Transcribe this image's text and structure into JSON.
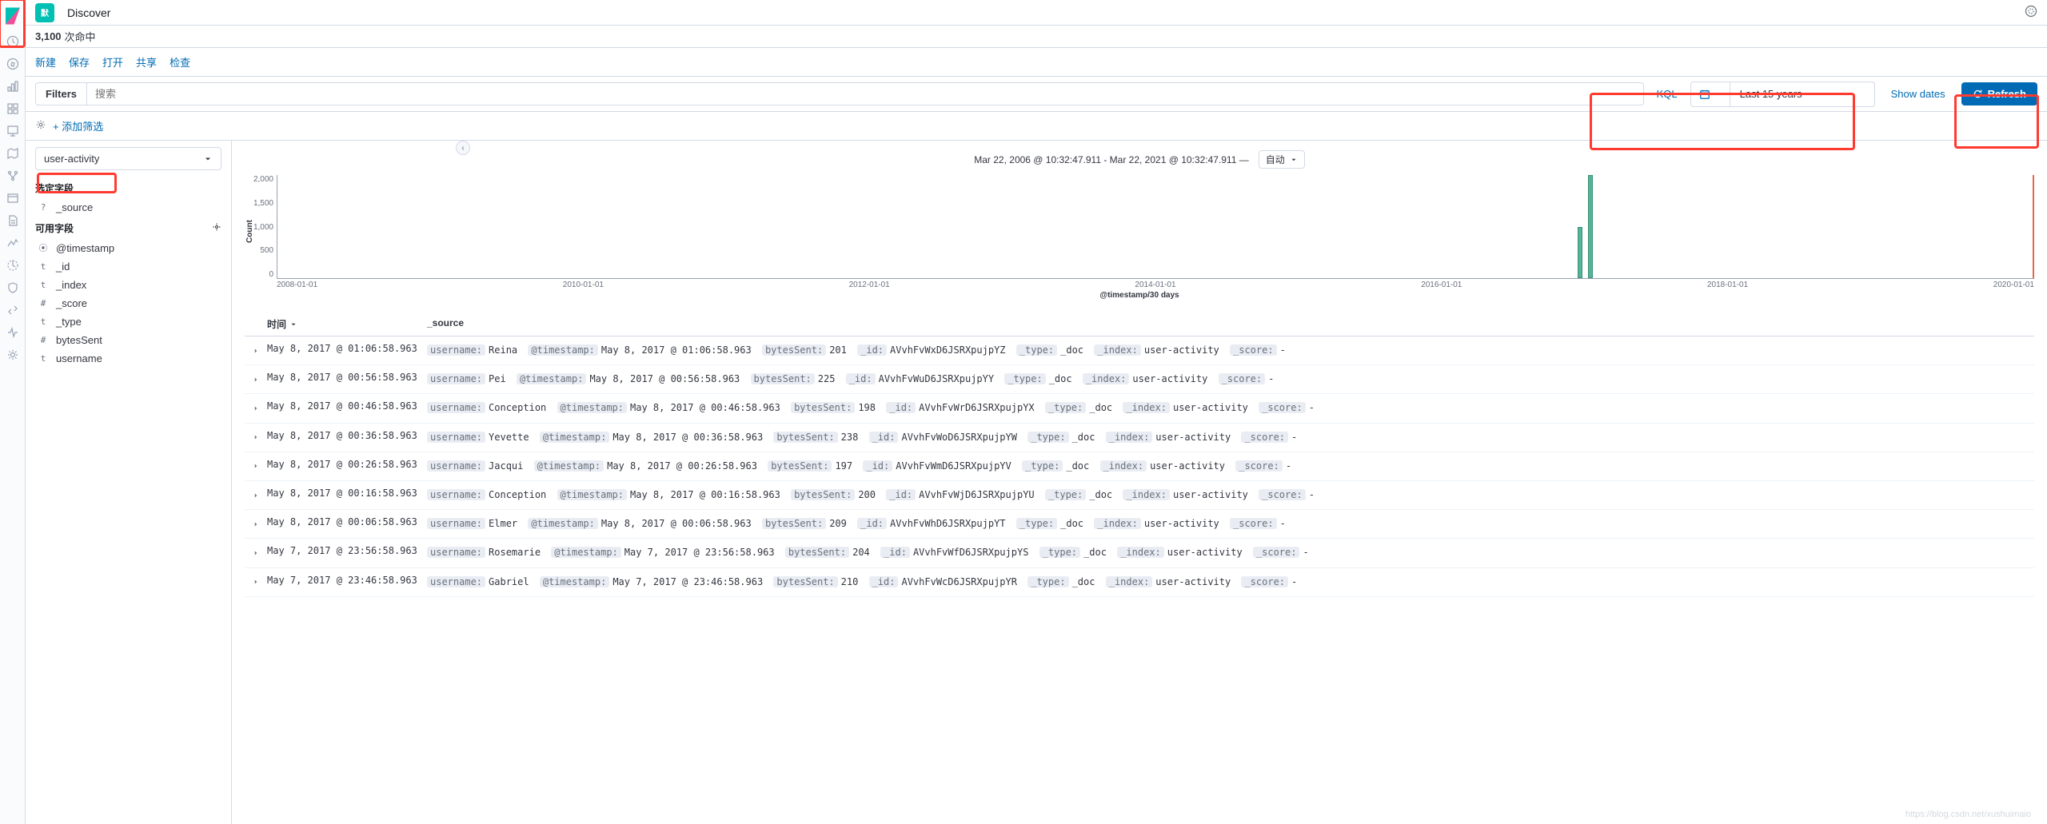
{
  "app": {
    "badge": "默",
    "title": "Discover"
  },
  "hits": {
    "count": "3,100",
    "label": "次命中"
  },
  "actions": [
    "新建",
    "保存",
    "打开",
    "共享",
    "检查"
  ],
  "search": {
    "filters_label": "Filters",
    "placeholder": "搜索",
    "kql": "KQL",
    "date_text": "Last 15 years",
    "show_dates": "Show dates",
    "refresh": "Refresh"
  },
  "filterrow": {
    "add_filter": "+ 添加筛选"
  },
  "sidebar": {
    "pattern": "user-activity",
    "selected_header": "选定字段",
    "available_header": "可用字段",
    "selected": [
      {
        "type": "?",
        "name": "_source"
      }
    ],
    "available": [
      {
        "type": "⦿",
        "name": "@timestamp"
      },
      {
        "type": "t",
        "name": "_id"
      },
      {
        "type": "t",
        "name": "_index"
      },
      {
        "type": "#",
        "name": "_score"
      },
      {
        "type": "t",
        "name": "_type"
      },
      {
        "type": "#",
        "name": "bytesSent"
      },
      {
        "type": "t",
        "name": "username"
      }
    ]
  },
  "chart_header": {
    "range": "Mar 22, 2006 @ 10:32:47.911 - Mar 22, 2021 @ 10:32:47.911 —",
    "interval": "自动"
  },
  "chart_data": {
    "type": "bar",
    "ylabel": "Count",
    "xlabel": "@timestamp/30 days",
    "yticks": [
      "2,000",
      "1,500",
      "1,000",
      "500",
      "0"
    ],
    "xticks": [
      "2008-01-01",
      "2010-01-01",
      "2012-01-01",
      "2014-01-01",
      "2016-01-01",
      "2018-01-01",
      "2020-01-01"
    ],
    "ylim": [
      0,
      2000
    ],
    "bars": [
      {
        "x_pct": 74.0,
        "value": 1000
      },
      {
        "x_pct": 74.6,
        "value": 2100
      }
    ]
  },
  "table": {
    "header_time": "时间",
    "header_source": "_source",
    "rows": [
      {
        "time": "May 8, 2017 @ 01:06:58.963",
        "username": "Reina",
        "ts": "May 8, 2017 @ 01:06:58.963",
        "bytesSent": "201",
        "id": "AVvhFvWxD6JSRXpujpYZ",
        "type": "_doc",
        "index": "user-activity",
        "score": "-"
      },
      {
        "time": "May 8, 2017 @ 00:56:58.963",
        "username": "Pei",
        "ts": "May 8, 2017 @ 00:56:58.963",
        "bytesSent": "225",
        "id": "AVvhFvWuD6JSRXpujpYY",
        "type": "_doc",
        "index": "user-activity",
        "score": "-"
      },
      {
        "time": "May 8, 2017 @ 00:46:58.963",
        "username": "Conception",
        "ts": "May 8, 2017 @ 00:46:58.963",
        "bytesSent": "198",
        "id": "AVvhFvWrD6JSRXpujpYX",
        "type": "_doc",
        "index": "user-activity",
        "score": "-"
      },
      {
        "time": "May 8, 2017 @ 00:36:58.963",
        "username": "Yevette",
        "ts": "May 8, 2017 @ 00:36:58.963",
        "bytesSent": "238",
        "id": "AVvhFvWoD6JSRXpujpYW",
        "type": "_doc",
        "index": "user-activity",
        "score": "-"
      },
      {
        "time": "May 8, 2017 @ 00:26:58.963",
        "username": "Jacqui",
        "ts": "May 8, 2017 @ 00:26:58.963",
        "bytesSent": "197",
        "id": "AVvhFvWmD6JSRXpujpYV",
        "type": "_doc",
        "index": "user-activity",
        "score": "-"
      },
      {
        "time": "May 8, 2017 @ 00:16:58.963",
        "username": "Conception",
        "ts": "May 8, 2017 @ 00:16:58.963",
        "bytesSent": "200",
        "id": "AVvhFvWjD6JSRXpujpYU",
        "type": "_doc",
        "index": "user-activity",
        "score": "-"
      },
      {
        "time": "May 8, 2017 @ 00:06:58.963",
        "username": "Elmer",
        "ts": "May 8, 2017 @ 00:06:58.963",
        "bytesSent": "209",
        "id": "AVvhFvWhD6JSRXpujpYT",
        "type": "_doc",
        "index": "user-activity",
        "score": "-"
      },
      {
        "time": "May 7, 2017 @ 23:56:58.963",
        "username": "Rosemarie",
        "ts": "May 7, 2017 @ 23:56:58.963",
        "bytesSent": "204",
        "id": "AVvhFvWfD6JSRXpujpYS",
        "type": "_doc",
        "index": "user-activity",
        "score": "-"
      },
      {
        "time": "May 7, 2017 @ 23:46:58.963",
        "username": "Gabriel",
        "ts": "May 7, 2017 @ 23:46:58.963",
        "bytesSent": "210",
        "id": "AVvhFvWcD6JSRXpujpYR",
        "type": "_doc",
        "index": "user-activity",
        "score": "-"
      }
    ]
  },
  "watermark": "https://blog.csdn.net/xushuimaio"
}
